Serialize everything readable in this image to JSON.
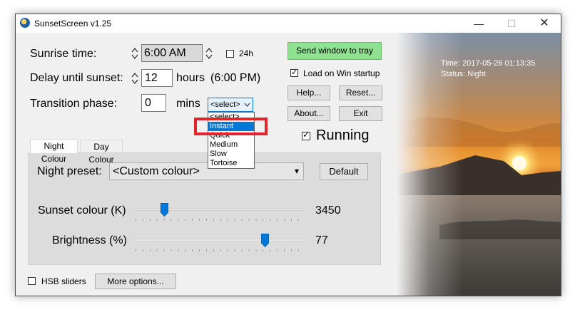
{
  "window": {
    "title": "SunsetScreen v1.25",
    "controls": {
      "minimize": "—",
      "maximize": "☐",
      "close": "✕"
    }
  },
  "sunrise": {
    "label": "Sunrise time:",
    "value": "6:00 AM",
    "format_label": "24h",
    "format_24h": false
  },
  "delay": {
    "label": "Delay until sunset:",
    "value": "12",
    "unit": "hours",
    "computed": "(6:00 PM)"
  },
  "transition": {
    "label": "Transition phase:",
    "value": "0",
    "unit": "mins",
    "select_value": "<select>",
    "dropdown_options": [
      "<select>",
      "Instant",
      "Quick",
      "Medium",
      "Slow",
      "Tortoise"
    ],
    "highlighted_option": "Instant"
  },
  "buttons": {
    "send_to_tray": "Send window to tray",
    "help": "Help...",
    "reset": "Reset...",
    "about": "About...",
    "exit": "Exit",
    "default": "Default",
    "more_options": "More options..."
  },
  "load_on_startup": {
    "label": "Load on Win startup",
    "checked": true
  },
  "running": {
    "label": "Running",
    "checked": true
  },
  "tabs": [
    {
      "label": "Night Colour",
      "active": true
    },
    {
      "label": "Day Colour",
      "active": false
    }
  ],
  "night": {
    "preset_label": "Night preset:",
    "preset_value": "<Custom colour>",
    "sunset_colour_label": "Sunset colour (K)",
    "sunset_colour_value": "3450",
    "sunset_colour_level": 0.18,
    "brightness_label": "Brightness (%)",
    "brightness_value": "77",
    "brightness_level": 0.77
  },
  "hsb_sliders": {
    "label": "HSB sliders",
    "checked": false
  },
  "photo": {
    "time_text": "Time: 2017-05-26 01:13:35",
    "status_text": "Status: Night"
  },
  "colors": {
    "accent": "#0078d7",
    "send_button": "#8fe28f",
    "highlight_outline": "#e0252f"
  },
  "icons": [
    "app-sun-icon",
    "spin-arrows-icon",
    "chevron-down-icon",
    "check-icon",
    "slider-thumb-icon"
  ]
}
